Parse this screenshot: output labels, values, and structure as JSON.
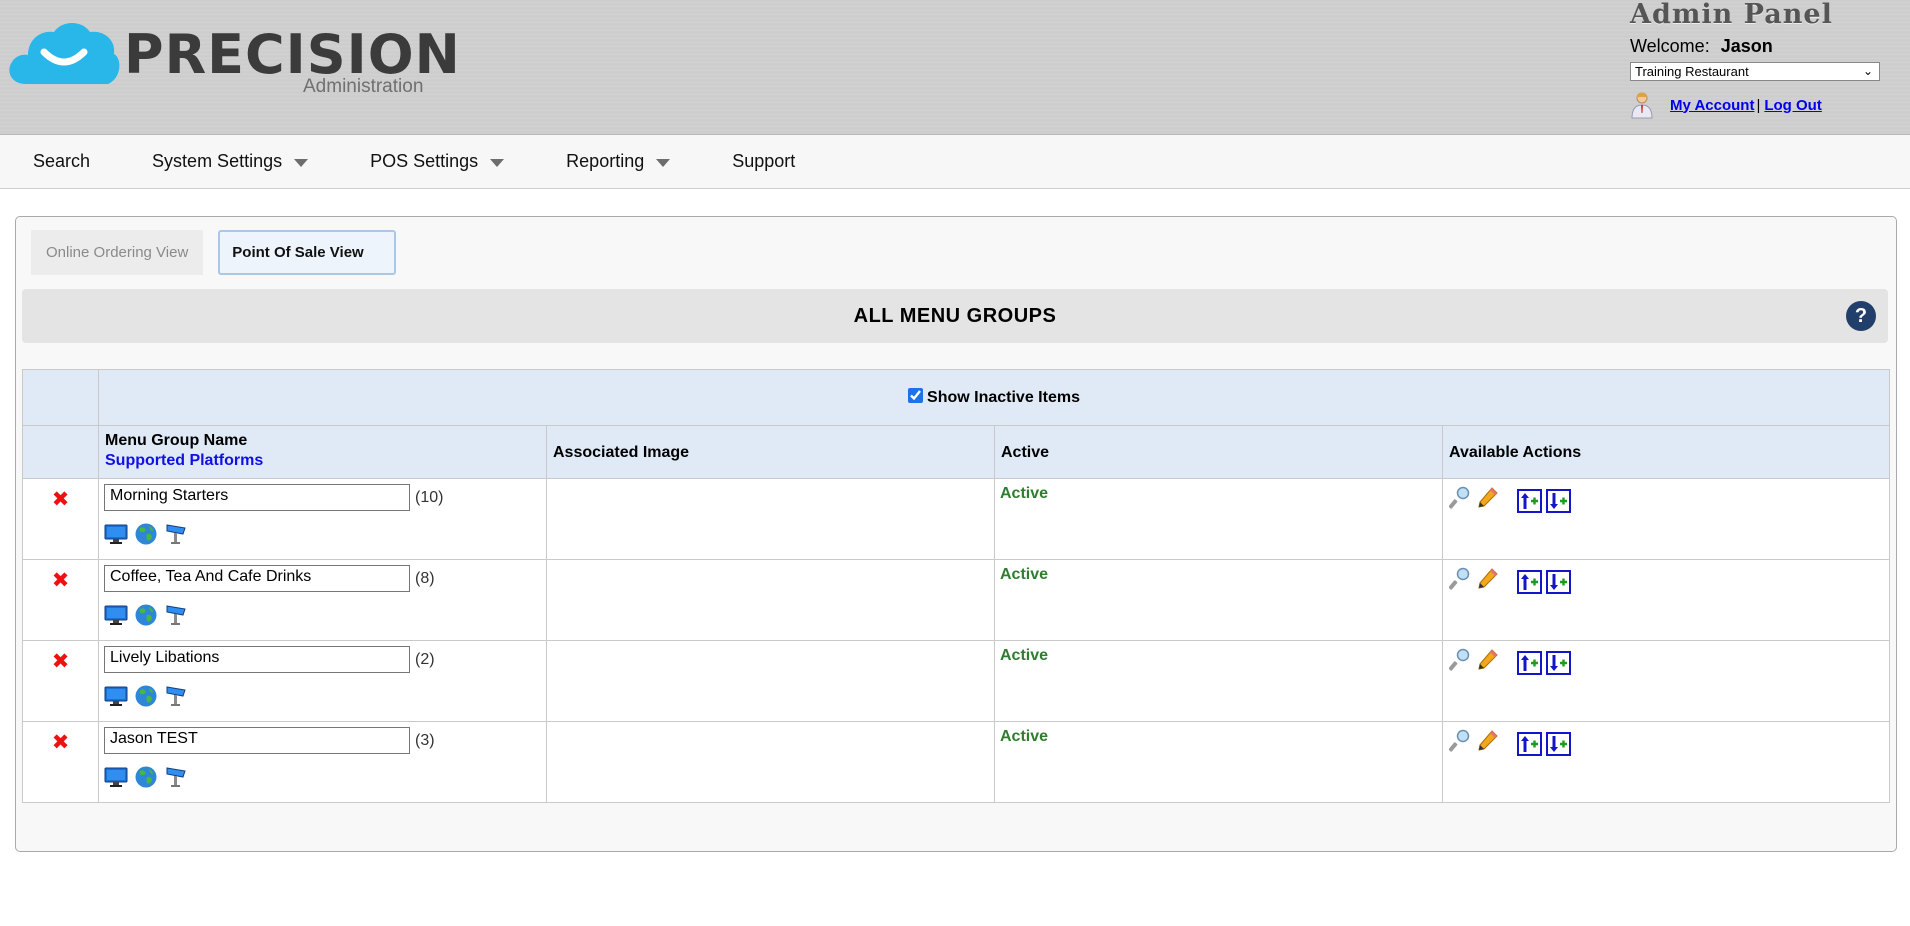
{
  "brand": {
    "name": "PRECISION",
    "subtitle": "Administration"
  },
  "header": {
    "panel_title": "Admin Panel",
    "welcome_label": "Welcome:",
    "user_name": "Jason",
    "restaurant": "Training Restaurant",
    "my_account": "My Account",
    "separator": "|",
    "log_out": "Log Out"
  },
  "nav": [
    {
      "label": "Search",
      "dropdown": false
    },
    {
      "label": "System Settings",
      "dropdown": true
    },
    {
      "label": "POS Settings",
      "dropdown": true
    },
    {
      "label": "Reporting",
      "dropdown": true
    },
    {
      "label": "Support",
      "dropdown": false
    }
  ],
  "tabs": {
    "online": "Online Ordering View",
    "pos": "Point Of Sale View"
  },
  "page": {
    "title": "ALL MENU GROUPS",
    "help": "?"
  },
  "filter": {
    "label": "Show Inactive Items",
    "checked": true
  },
  "columns": {
    "name": "Menu Group Name",
    "platforms": "Supported Platforms",
    "image": "Associated Image",
    "active": "Active",
    "actions": "Available Actions"
  },
  "rows": [
    {
      "name": "Morning Starters",
      "count": "(10)",
      "status": "Active"
    },
    {
      "name": "Coffee, Tea And Cafe Drinks",
      "count": "(8)",
      "status": "Active"
    },
    {
      "name": "Lively Libations",
      "count": "(2)",
      "status": "Active"
    },
    {
      "name": "Jason TEST",
      "count": "(3)",
      "status": "Active"
    }
  ],
  "icons": {
    "delete": "close-icon",
    "platforms": [
      "monitor-icon",
      "globe-icon",
      "kiosk-icon"
    ],
    "actions": [
      "view-icon",
      "edit-icon",
      "move-up-icon",
      "move-down-icon"
    ]
  },
  "colors": {
    "active": "#2f7d2f",
    "delete": "#e11111",
    "link": "#0000ee",
    "help": "#223f6b",
    "logo_cloud": "#29b6e8"
  }
}
